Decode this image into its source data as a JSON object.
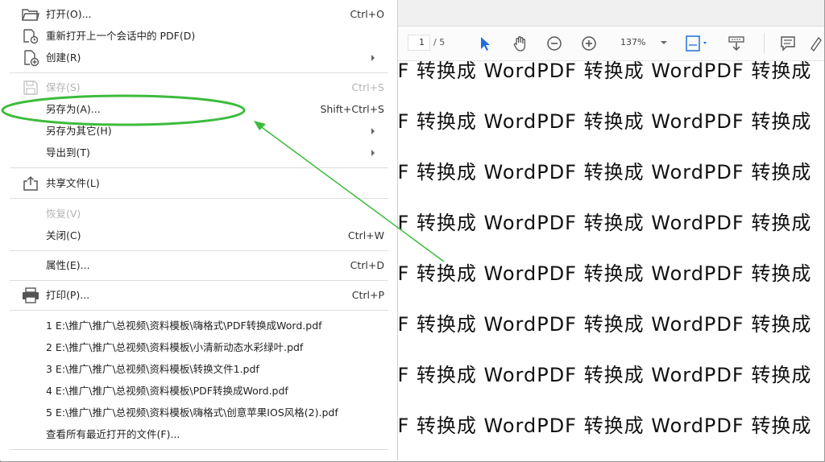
{
  "menu": {
    "open": {
      "label": "打开(O)...",
      "shortcut": "Ctrl+O"
    },
    "reopen": {
      "label": "重新打开上一个会话中的 PDF(D)"
    },
    "create": {
      "label": "创建(R)"
    },
    "save": {
      "label": "保存(S)",
      "shortcut": "Ctrl+S"
    },
    "save_as": {
      "label": "另存为(A)...",
      "shortcut": "Shift+Ctrl+S"
    },
    "save_as_other": {
      "label": "另存为其它(H)"
    },
    "export_to": {
      "label": "导出到(T)"
    },
    "share": {
      "label": "共享文件(L)"
    },
    "revert": {
      "label": "恢复(V)"
    },
    "close": {
      "label": "关闭(C)",
      "shortcut": "Ctrl+W"
    },
    "properties": {
      "label": "属性(E)...",
      "shortcut": "Ctrl+D"
    },
    "print": {
      "label": "打印(P)...",
      "shortcut": "Ctrl+P"
    },
    "recent_files": [
      "1 E:\\推广\\推广\\总视频\\资料模板\\嗨格式\\PDF转换成Word.pdf",
      "2 E:\\推广\\推广\\总视频\\资料模板\\小清新动态水彩绿叶.pdf",
      "3 E:\\推广\\推广\\总视频\\资料模板\\转换文件1.pdf",
      "4 E:\\推广\\推广\\总视频\\资料模板\\PDF转换成Word.pdf",
      "5 E:\\推广\\推广\\总视频\\资料模板\\嗨格式\\创意苹果IOS风格(2).pdf"
    ],
    "view_all_recent": "查看所有最近打开的文件(F)..."
  },
  "toolbar": {
    "page_current": "1",
    "page_total": "/ 5",
    "zoom": "137%"
  },
  "document": {
    "line_text": "DF 转换成 WordPDF 转换成 WordPDF 转换成"
  },
  "colors": {
    "annotation": "#3dbb3d",
    "accent_blue": "#1e6fd9"
  }
}
